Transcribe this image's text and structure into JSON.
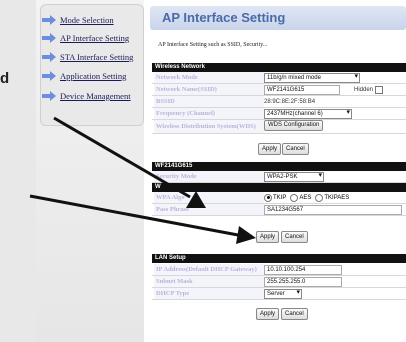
{
  "left_letter": "d",
  "sidebar": {
    "items": [
      {
        "label": "Mode Selection"
      },
      {
        "label": "AP Interface Setting"
      },
      {
        "label": "STA Interface Setting"
      },
      {
        "label": "Application Setting"
      },
      {
        "label": "Device Management"
      }
    ]
  },
  "page": {
    "title": "AP Interface Setting",
    "description": "AP Interface Setting such as SSID, Security..."
  },
  "wireless": {
    "header": "Wireless Network",
    "network_mode": {
      "label": "Network Mode",
      "value": "11b/g/n mixed mode"
    },
    "ssid": {
      "label": "Network Name(SSID)",
      "value": "WF2141G615",
      "hidden_label": "Hidden"
    },
    "bssid": {
      "label": "BSSID",
      "value": "28:9C:8E:2F:58:B4"
    },
    "frequency": {
      "label": "Frequency (Channel)",
      "value": "2437MHz(channel 6)"
    },
    "wds": {
      "label": "Wireless Distribution System(WDS)",
      "button": "WDS Configuration"
    },
    "apply": "Apply",
    "cancel": "Cancel"
  },
  "security": {
    "header": "WF2141G615",
    "mode": {
      "label": "Security Mode",
      "value": "WPA2-PSK"
    },
    "sub_header": "W",
    "wpa_algo": {
      "label": "WPA Algo",
      "options": [
        "TKIP",
        "AES",
        "TKIPAES"
      ],
      "selected": "TKIP"
    },
    "pass_phrase": {
      "label": "Pass Phrase",
      "value": "SA1234G567"
    },
    "apply": "Apply",
    "cancel": "Cancel"
  },
  "lan": {
    "header": "LAN Setup",
    "ip": {
      "label": "IP Address(Default DHCP Gateway)",
      "value": "10.10.100.254"
    },
    "mask": {
      "label": "Subnet Mask",
      "value": "255.255.255.0"
    },
    "dhcp": {
      "label": "DHCP Type",
      "value": "Server"
    },
    "apply": "Apply",
    "cancel": "Cancel"
  },
  "colors": {
    "accent": "#4a6aa8",
    "header_bg": "#111111",
    "label_text": "#b8b4d8"
  }
}
